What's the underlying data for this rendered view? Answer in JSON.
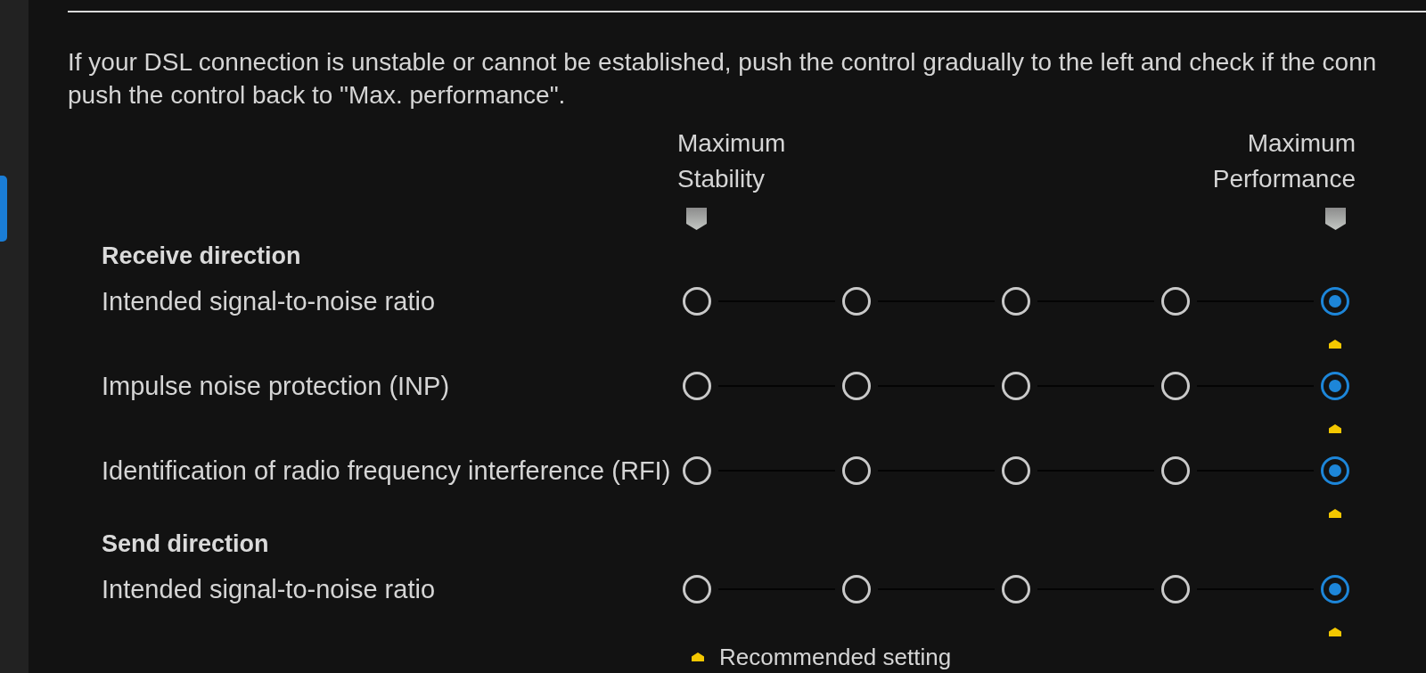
{
  "description": {
    "lines": [
      "If your DSL connection is unstable or cannot be established, push the control gradually to the left and check if the conn",
      "push the control back to \"Max. performance\"."
    ]
  },
  "scale": {
    "left_label": "Maximum Stability",
    "right_label": "Maximum Performance"
  },
  "sections": [
    {
      "heading": "Receive direction",
      "rows": [
        {
          "label": "Intended signal-to-noise ratio",
          "options": [
            {
              "selected": false,
              "recommended": false
            },
            {
              "selected": false,
              "recommended": false
            },
            {
              "selected": false,
              "recommended": false
            },
            {
              "selected": false,
              "recommended": false
            },
            {
              "selected": true,
              "recommended": true
            }
          ]
        },
        {
          "label": "Impulse noise protection (INP)",
          "options": [
            {
              "selected": false,
              "recommended": false
            },
            {
              "selected": false,
              "recommended": false
            },
            {
              "selected": false,
              "recommended": false
            },
            {
              "selected": false,
              "recommended": false
            },
            {
              "selected": true,
              "recommended": true
            }
          ]
        },
        {
          "label": "Identification of radio frequency interference (RFI)",
          "options": [
            {
              "selected": false,
              "recommended": false
            },
            {
              "selected": false,
              "recommended": false
            },
            {
              "selected": false,
              "recommended": false
            },
            {
              "selected": false,
              "recommended": false
            },
            {
              "selected": true,
              "recommended": true
            }
          ]
        }
      ]
    },
    {
      "heading": "Send direction",
      "rows": [
        {
          "label": "Intended signal-to-noise ratio",
          "options": [
            {
              "selected": false,
              "recommended": false
            },
            {
              "selected": false,
              "recommended": false
            },
            {
              "selected": false,
              "recommended": false
            },
            {
              "selected": false,
              "recommended": false
            },
            {
              "selected": true,
              "recommended": true
            }
          ]
        }
      ]
    }
  ],
  "legend": {
    "text": "Recommended setting"
  }
}
